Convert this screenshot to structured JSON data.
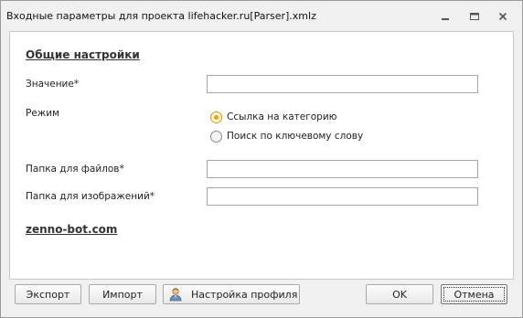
{
  "window": {
    "title": "Входные параметры для проекта lifehacker.ru[Parser].xmlz"
  },
  "form": {
    "section_title": "Общие настройки",
    "fields": {
      "value": {
        "label": "Значение*",
        "value": ""
      },
      "mode": {
        "label": "Режим",
        "options": [
          {
            "label": "Ссылка на категорию",
            "checked": true
          },
          {
            "label": "Поиск по ключевому слову",
            "checked": false
          }
        ]
      },
      "files_folder": {
        "label": "Папка для файлов*",
        "value": ""
      },
      "images_folder": {
        "label": "Папка для изображений*",
        "value": ""
      }
    },
    "site_link": "zenno-bot.com"
  },
  "buttons": {
    "export": "Экспорт",
    "import": "Импорт",
    "profile": "Настройка профиля",
    "ok": "OK",
    "cancel": "Отмена"
  },
  "icons": {
    "profile_button_icon": "user-icon",
    "radio_accent": "#e2a51a"
  }
}
